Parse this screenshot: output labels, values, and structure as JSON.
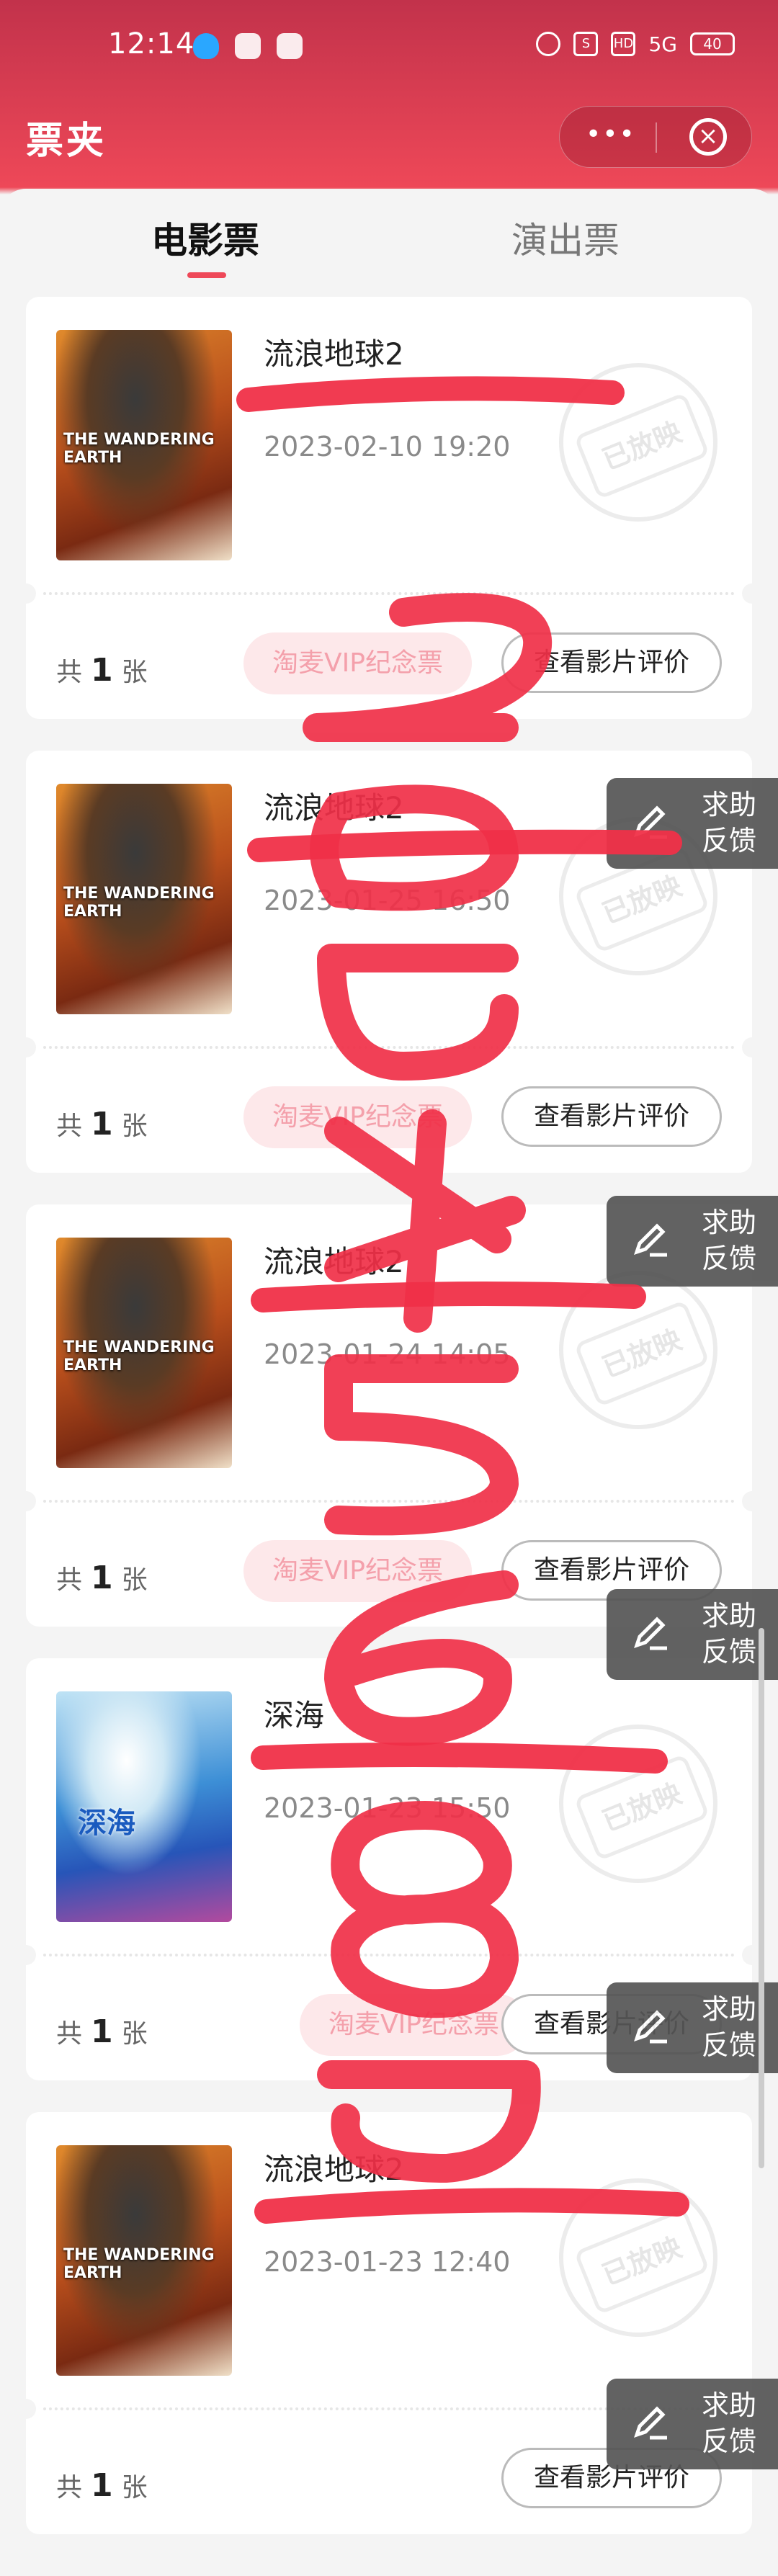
{
  "status_bar": {
    "time": "12:14",
    "signal_text": "5G",
    "battery": "40",
    "hd": "HD"
  },
  "header": {
    "title": "票夹"
  },
  "tabs": [
    {
      "label": "电影票"
    },
    {
      "label": "演出票"
    }
  ],
  "tickets": [
    {
      "movie": "流浪地球2",
      "cinema": "",
      "datetime": "2023-02-10 19:20",
      "count_prefix": "共",
      "count": "1",
      "count_unit": "张",
      "tag": "淘麦VIP纪念票",
      "button": "查看影片评价",
      "stamp": "已放映"
    },
    {
      "movie": "流浪地球2",
      "cinema": "",
      "datetime": "2023-01-25 16:50",
      "count_prefix": "共",
      "count": "1",
      "count_unit": "张",
      "tag": "淘麦VIP纪念票",
      "button": "查看影片评价",
      "stamp": "已放映"
    },
    {
      "movie": "流浪地球2",
      "cinema": "",
      "datetime": "2023-01-24 14:05",
      "count_prefix": "共",
      "count": "1",
      "count_unit": "张",
      "tag": "淘麦VIP纪念票",
      "button": "查看影片评价",
      "stamp": "已放映"
    },
    {
      "movie": "深海",
      "cinema": "",
      "datetime": "2023-01-23 15:50",
      "count_prefix": "共",
      "count": "1",
      "count_unit": "张",
      "tag": "淘麦VIP纪念票",
      "button": "查看影片评价",
      "stamp": "已放映"
    },
    {
      "movie": "流浪地球2",
      "cinema": "",
      "datetime": "2023-01-23 12:40",
      "count_prefix": "共",
      "count": "1",
      "count_unit": "张",
      "tag": "",
      "button": "查看影片评价",
      "stamp": "已放映"
    }
  ],
  "feedback": {
    "label": "求助反馈"
  },
  "poster_labels": {
    "wandering": "THE WANDERING EARTH",
    "deepsea": "深海"
  },
  "handwritten_overlay": "2ob4568d",
  "colors": {
    "brand": "#ee4858",
    "header_dark": "#c2324b",
    "marker": "#f03048"
  }
}
